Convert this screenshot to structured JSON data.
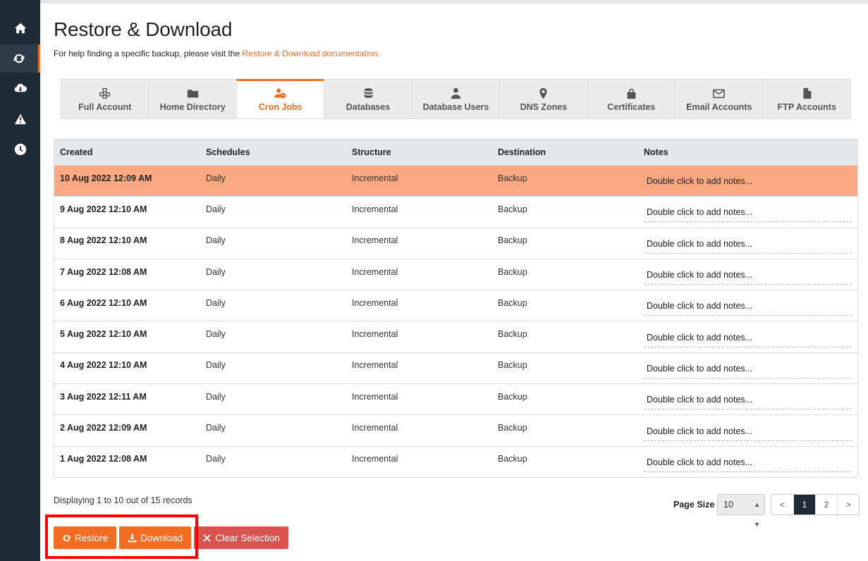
{
  "sidebar": {
    "items": [
      {
        "icon": "home-icon",
        "active": false
      },
      {
        "icon": "sync-icon",
        "active": true
      },
      {
        "icon": "cloud-download-icon",
        "active": false
      },
      {
        "icon": "warning-icon",
        "active": false
      },
      {
        "icon": "clock-icon",
        "active": false
      }
    ]
  },
  "page": {
    "title": "Restore & Download",
    "help_prefix": "For help finding a specific backup, please visit the ",
    "help_link": "Restore & Download documentation."
  },
  "tabs": [
    {
      "label": "Full Account",
      "icon": "cubes-icon"
    },
    {
      "label": "Home Directory",
      "icon": "folder-icon"
    },
    {
      "label": "Cron Jobs",
      "icon": "user-clock-icon",
      "active": true
    },
    {
      "label": "Databases",
      "icon": "database-icon"
    },
    {
      "label": "Database Users",
      "icon": "user-tie-icon"
    },
    {
      "label": "DNS Zones",
      "icon": "map-marker-icon"
    },
    {
      "label": "Certificates",
      "icon": "lock-icon"
    },
    {
      "label": "Email Accounts",
      "icon": "envelope-icon"
    },
    {
      "label": "FTP Accounts",
      "icon": "file-icon"
    }
  ],
  "table": {
    "headers": [
      "Created",
      "Schedules",
      "Structure",
      "Destination",
      "Notes"
    ],
    "rows": [
      {
        "created": "10 Aug 2022 12:09 AM",
        "schedule": "Daily",
        "structure": "Incremental",
        "destination": "Backup",
        "notes": "Double click to add notes..."
      },
      {
        "created": "9 Aug 2022 12:10 AM",
        "schedule": "Daily",
        "structure": "Incremental",
        "destination": "Backup",
        "notes": "Double click to add notes..."
      },
      {
        "created": "8 Aug 2022 12:10 AM",
        "schedule": "Daily",
        "structure": "Incremental",
        "destination": "Backup",
        "notes": "Double click to add notes..."
      },
      {
        "created": "7 Aug 2022 12:08 AM",
        "schedule": "Daily",
        "structure": "Incremental",
        "destination": "Backup",
        "notes": "Double click to add notes..."
      },
      {
        "created": "6 Aug 2022 12:10 AM",
        "schedule": "Daily",
        "structure": "Incremental",
        "destination": "Backup",
        "notes": "Double click to add notes..."
      },
      {
        "created": "5 Aug 2022 12:10 AM",
        "schedule": "Daily",
        "structure": "Incremental",
        "destination": "Backup",
        "notes": "Double click to add notes..."
      },
      {
        "created": "4 Aug 2022 12:10 AM",
        "schedule": "Daily",
        "structure": "Incremental",
        "destination": "Backup",
        "notes": "Double click to add notes..."
      },
      {
        "created": "3 Aug 2022 12:11 AM",
        "schedule": "Daily",
        "structure": "Incremental",
        "destination": "Backup",
        "notes": "Double click to add notes..."
      },
      {
        "created": "2 Aug 2022 12:09 AM",
        "schedule": "Daily",
        "structure": "Incremental",
        "destination": "Backup",
        "notes": "Double click to add notes..."
      },
      {
        "created": "1 Aug 2022 12:08 AM",
        "schedule": "Daily",
        "structure": "Incremental",
        "destination": "Backup",
        "notes": "Double click to add notes..."
      }
    ],
    "selected_row": 0
  },
  "footer": {
    "records": "Displaying 1 to 10 out of 15 records",
    "page_size_label": "Page Size",
    "page_size_value": "10",
    "pager": [
      "<",
      "1",
      "2",
      ">"
    ],
    "current_page": "1"
  },
  "actions": {
    "restore": "Restore",
    "download": "Download",
    "clear": "Clear Selection"
  },
  "colors": {
    "accent": "#f26c22",
    "selected_row": "#f9a882",
    "sidebar": "#1e2a36",
    "danger": "#d9534f",
    "highlight_box": "#ff0000"
  }
}
